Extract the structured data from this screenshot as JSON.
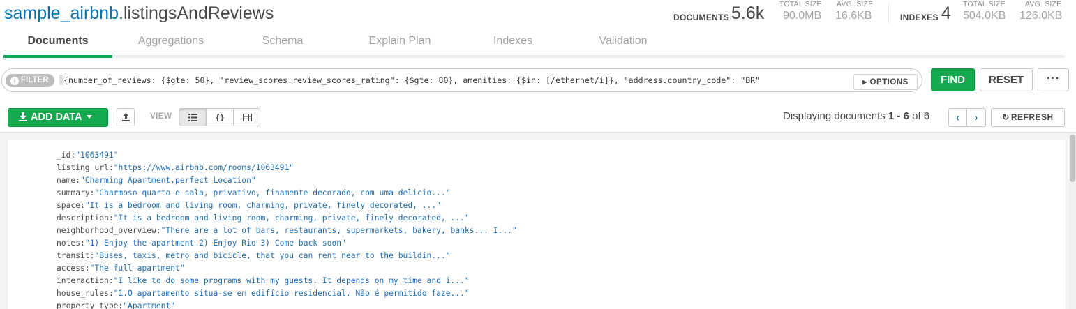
{
  "header": {
    "db_name": "sample_airbnb",
    "dot": ".",
    "collection_name": "listingsAndReviews",
    "documents_label": "DOCUMENTS",
    "documents_count": "5.6k",
    "docs_total_size_label": "TOTAL SIZE",
    "docs_total_size": "90.0MB",
    "docs_avg_size_label": "AVG. SIZE",
    "docs_avg_size": "16.6KB",
    "indexes_label": "INDEXES",
    "indexes_count": "4",
    "idx_total_size_label": "TOTAL SIZE",
    "idx_total_size": "504.0KB",
    "idx_avg_size_label": "AVG. SIZE",
    "idx_avg_size": "126.0KB"
  },
  "tabs": [
    {
      "label": "Documents",
      "active": true
    },
    {
      "label": "Aggregations"
    },
    {
      "label": "Schema"
    },
    {
      "label": "Explain Plan"
    },
    {
      "label": "Indexes"
    },
    {
      "label": "Validation"
    }
  ],
  "filter": {
    "badge_label": "FILTER",
    "query": "{number_of_reviews: {$gte: 50}, \"review_scores.review_scores_rating\": {$gte: 80}, amenities: {$in: [/ethernet/i]}, \"address.country_code\": \"BR\"",
    "options_label": "OPTIONS",
    "find_label": "FIND",
    "reset_label": "RESET",
    "more_label": "···"
  },
  "toolbar": {
    "add_data_label": "ADD DATA",
    "view_label": "VIEW",
    "view_modes": [
      "list",
      "json",
      "table"
    ],
    "displaying_prefix": "Displaying documents ",
    "range": "1 - 6",
    "of_text": " of ",
    "total": "6",
    "refresh_label": "REFRESH"
  },
  "document": {
    "fields": [
      {
        "key": "_id",
        "value": "\"1063491\""
      },
      {
        "key": "listing_url",
        "value": "\"https://www.airbnb.com/rooms/1063491\""
      },
      {
        "key": "name",
        "value": "\"Charming Apartment,perfect Location\""
      },
      {
        "key": "summary",
        "value": "\"Charmoso quarto e sala, privativo, finamente decorado, com uma delicio...\""
      },
      {
        "key": "space",
        "value": "\"It is a bedroom and living room, charming, private, finely decorated, ...\""
      },
      {
        "key": "description",
        "value": "\"It is a bedroom and living room, charming, private, finely decorated, ...\""
      },
      {
        "key": "neighborhood_overview",
        "value": "\"There are a lot of bars, restaurants, supermarkets, bakery, banks... I...\""
      },
      {
        "key": "notes",
        "value": "\"1) Enjoy the apartment 2) Enjoy Rio 3) Come back soon\""
      },
      {
        "key": "transit",
        "value": "\"Buses, taxis, metro and bicicle, that you can rent near to the buildin...\""
      },
      {
        "key": "access",
        "value": "\"The full apartment\""
      },
      {
        "key": "interaction",
        "value": "\"I like to do some programs with my guests. It depends on my time and i...\""
      },
      {
        "key": "house_rules",
        "value": "\"1.O apartamento situa-se em edifício residencial. Não é permitido faze...\""
      },
      {
        "key": "property_type",
        "value": "\"Apartment\""
      }
    ]
  },
  "colors": {
    "accent_green": "#13aa52",
    "link_blue": "#0d74b3",
    "value_blue": "#1f6db5"
  }
}
